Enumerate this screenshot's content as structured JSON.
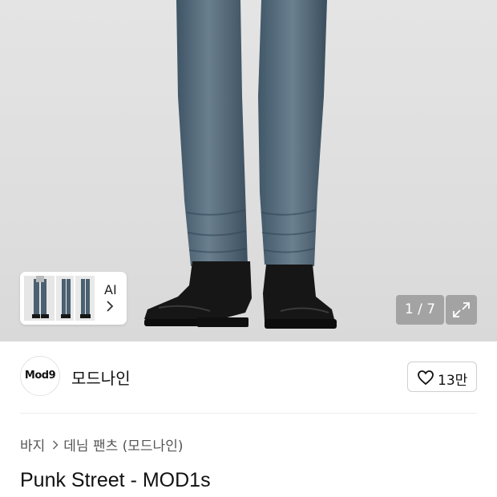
{
  "gallery": {
    "counter": "1 / 7",
    "ai_label": "AI",
    "thumb_count": 3
  },
  "brand": {
    "logo_text": "Mod9",
    "name": "모드나인",
    "like_count": "13만"
  },
  "breadcrumb": {
    "category": "바지",
    "subcategory": "데님 팬츠 (모드나인)"
  },
  "product": {
    "title": "Punk Street - MOD1s"
  },
  "colors": {
    "denim": "#4f6576",
    "boot": "#161616",
    "bg": "#dedede"
  }
}
